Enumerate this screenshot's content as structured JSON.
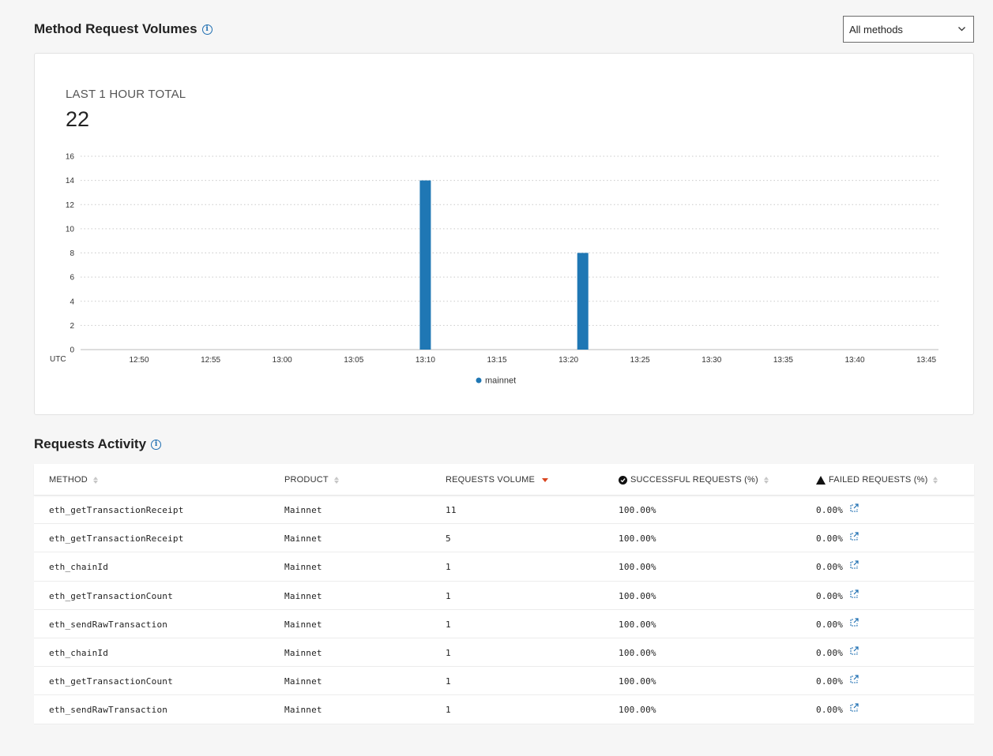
{
  "volumes": {
    "title": "Method Request Volumes",
    "info_icon": "info-icon",
    "filter": {
      "selected": "All methods",
      "icon": "chevron-down-icon"
    },
    "total_label": "LAST 1 HOUR TOTAL",
    "total_value": "22"
  },
  "chart_data": {
    "type": "bar",
    "ylim": [
      0,
      16
    ],
    "yticks": [
      0,
      2,
      4,
      6,
      8,
      10,
      12,
      14,
      16
    ],
    "xlabel": "UTC",
    "xticks": [
      "12:50",
      "12:55",
      "13:00",
      "13:05",
      "13:10",
      "13:15",
      "13:20",
      "13:25",
      "13:30",
      "13:35",
      "13:40",
      "13:45"
    ],
    "grid": "dotted horizontal",
    "legend_position": "bottom-center",
    "series": [
      {
        "name": "mainnet",
        "color": "#1f77b4",
        "points": [
          {
            "x": "13:10",
            "y": 14
          },
          {
            "x": "13:21",
            "y": 8
          }
        ]
      }
    ]
  },
  "activity": {
    "title": "Requests Activity",
    "info_icon": "info-icon",
    "columns": [
      {
        "label": "METHOD",
        "sort": "none"
      },
      {
        "label": "PRODUCT",
        "sort": "none"
      },
      {
        "label": "REQUESTS VOLUME",
        "sort": "desc",
        "sort_color": "#d9451f"
      },
      {
        "label": "SUCCESSFUL REQUESTS (%)",
        "sort": "none",
        "icon": "check-circle-icon"
      },
      {
        "label": "FAILED REQUESTS (%)",
        "sort": "none",
        "icon": "warning-icon"
      }
    ],
    "rows": [
      {
        "method": "eth_getTransactionReceipt",
        "product": "Mainnet",
        "volume": "11",
        "success": "100.00%",
        "failed": "0.00%"
      },
      {
        "method": "eth_getTransactionReceipt",
        "product": "Mainnet",
        "volume": "5",
        "success": "100.00%",
        "failed": "0.00%"
      },
      {
        "method": "eth_chainId",
        "product": "Mainnet",
        "volume": "1",
        "success": "100.00%",
        "failed": "0.00%"
      },
      {
        "method": "eth_getTransactionCount",
        "product": "Mainnet",
        "volume": "1",
        "success": "100.00%",
        "failed": "0.00%"
      },
      {
        "method": "eth_sendRawTransaction",
        "product": "Mainnet",
        "volume": "1",
        "success": "100.00%",
        "failed": "0.00%"
      },
      {
        "method": "eth_chainId",
        "product": "Mainnet",
        "volume": "1",
        "success": "100.00%",
        "failed": "0.00%"
      },
      {
        "method": "eth_getTransactionCount",
        "product": "Mainnet",
        "volume": "1",
        "success": "100.00%",
        "failed": "0.00%"
      },
      {
        "method": "eth_sendRawTransaction",
        "product": "Mainnet",
        "volume": "1",
        "success": "100.00%",
        "failed": "0.00%"
      }
    ],
    "row_link_icon": "external-link-icon"
  }
}
